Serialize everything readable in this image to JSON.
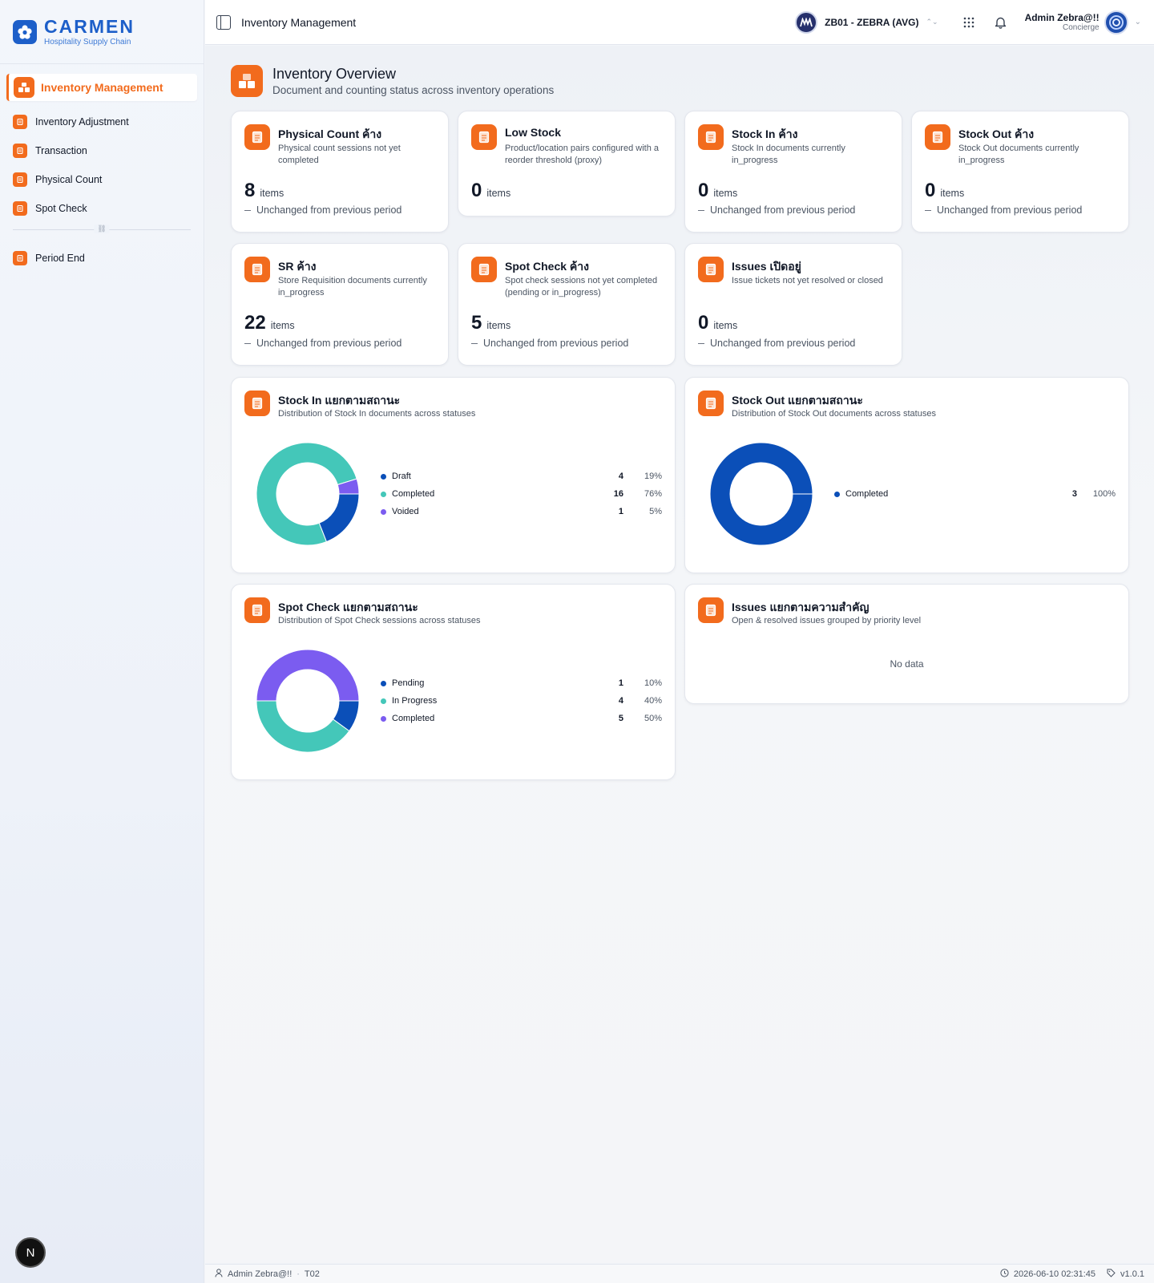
{
  "brand": {
    "name": "CARMEN",
    "tagline": "Hospitality Supply Chain"
  },
  "sidebar": {
    "active": {
      "label": "Inventory Management",
      "icon": "boxes-icon"
    },
    "items": [
      {
        "label": "Inventory Adjustment",
        "icon": "adjust-icon"
      },
      {
        "label": "Transaction",
        "icon": "document-icon"
      },
      {
        "label": "Physical Count",
        "icon": "clipboard-icon"
      },
      {
        "label": "Spot Check",
        "icon": "spot-check-icon"
      }
    ],
    "items_bottom": [
      {
        "label": "Period End",
        "icon": "calendar-icon"
      }
    ]
  },
  "header": {
    "title": "Inventory Management",
    "business_unit": "ZB01 - ZEBRA (AVG)",
    "user_name": "Admin Zebra@!!",
    "user_role": "Concierge"
  },
  "page": {
    "title": "Inventory Overview",
    "subtitle": "Document and counting status across inventory operations"
  },
  "kpis": [
    {
      "title": "Physical Count ค้าง",
      "desc": "Physical count sessions not yet completed",
      "value": "8",
      "unit": "items",
      "delta": "Unchanged from previous period"
    },
    {
      "title": "Low Stock",
      "desc": "Product/location pairs configured with a reorder threshold (proxy)",
      "value": "0",
      "unit": "items",
      "delta": ""
    },
    {
      "title": "Stock In ค้าง",
      "desc": "Stock In documents currently in_progress",
      "value": "0",
      "unit": "items",
      "delta": "Unchanged from previous period"
    },
    {
      "title": "Stock Out ค้าง",
      "desc": "Stock Out documents currently in_progress",
      "value": "0",
      "unit": "items",
      "delta": "Unchanged from previous period"
    },
    {
      "title": "SR ค้าง",
      "desc": "Store Requisition documents currently in_progress",
      "value": "22",
      "unit": "items",
      "delta": "Unchanged from previous period"
    },
    {
      "title": "Spot Check ค้าง",
      "desc": "Spot check sessions not yet completed (pending or in_progress)",
      "value": "5",
      "unit": "items",
      "delta": "Unchanged from previous period"
    },
    {
      "title": "Issues เปิดอยู่",
      "desc": "Issue tickets not yet resolved or closed",
      "value": "0",
      "unit": "items",
      "delta": "Unchanged from previous period"
    }
  ],
  "charts": [
    {
      "title": "Stock In แยกตามสถานะ",
      "subtitle": "Distribution of Stock In documents across statuses",
      "segments": [
        {
          "label": "Draft",
          "count": "4",
          "pct": "19%",
          "value": 4,
          "color": "#0b4fb8"
        },
        {
          "label": "Completed",
          "count": "16",
          "pct": "76%",
          "value": 16,
          "color": "#44c7b9"
        },
        {
          "label": "Voided",
          "count": "1",
          "pct": "5%",
          "value": 1,
          "color": "#7b5cf0"
        }
      ]
    },
    {
      "title": "Stock Out แยกตามสถานะ",
      "subtitle": "Distribution of Stock Out documents across statuses",
      "segments": [
        {
          "label": "Completed",
          "count": "3",
          "pct": "100%",
          "value": 3,
          "color": "#0b4fb8"
        }
      ]
    },
    {
      "title": "Spot Check แยกตามสถานะ",
      "subtitle": "Distribution of Spot Check sessions across statuses",
      "segments": [
        {
          "label": "Pending",
          "count": "1",
          "pct": "10%",
          "value": 1,
          "color": "#0b4fb8"
        },
        {
          "label": "In Progress",
          "count": "4",
          "pct": "40%",
          "value": 4,
          "color": "#44c7b9"
        },
        {
          "label": "Completed",
          "count": "5",
          "pct": "50%",
          "value": 5,
          "color": "#7b5cf0"
        }
      ]
    },
    {
      "title": "Issues แยกตามความสำคัญ",
      "subtitle": "Open & resolved issues grouped by priority level",
      "no_data": "No data"
    }
  ],
  "chart_data": [
    {
      "type": "pie",
      "title": "Stock In แยกตามสถานะ",
      "categories": [
        "Draft",
        "Completed",
        "Voided"
      ],
      "values": [
        4,
        16,
        1
      ]
    },
    {
      "type": "pie",
      "title": "Stock Out แยกตามสถานะ",
      "categories": [
        "Completed"
      ],
      "values": [
        3
      ]
    },
    {
      "type": "pie",
      "title": "Spot Check แยกตามสถานะ",
      "categories": [
        "Pending",
        "In Progress",
        "Completed"
      ],
      "values": [
        1,
        4,
        5
      ]
    }
  ],
  "footer": {
    "user": "Admin Zebra@!!",
    "bu_code": "T02",
    "timestamp": "2026-06-10 02:31:45",
    "version": "v1.0.1"
  },
  "colors": {
    "accent": "#f26b1d",
    "brand": "#1d5fc9"
  }
}
